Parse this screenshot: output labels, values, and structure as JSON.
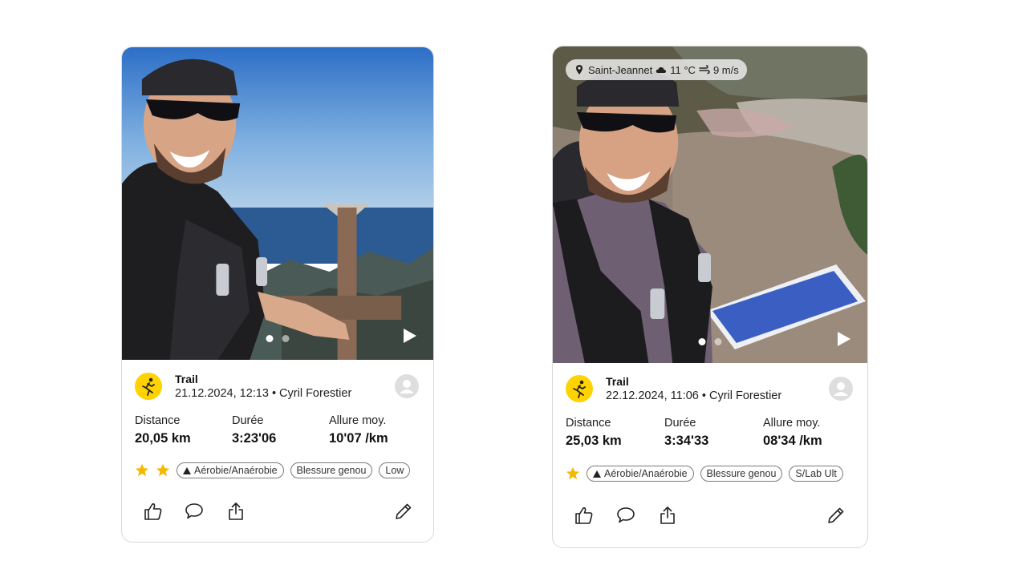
{
  "cards": [
    {
      "activity": "Trail",
      "meta": "21.12.2024, 12:13 • Cyril Forestier",
      "stats": [
        {
          "label": "Distance",
          "value": "20,05 km"
        },
        {
          "label": "Durée",
          "value": "3:23'06"
        },
        {
          "label": "Allure moy.",
          "value": "10'07 /km"
        }
      ],
      "rating": 2,
      "tags": [
        "Aérobie/Anaérobie",
        "Blessure genou",
        "Low"
      ],
      "photo_page": "1 of 2"
    },
    {
      "activity": "Trail",
      "meta": "22.12.2024, 11:06 • Cyril Forestier",
      "weather": {
        "location": "Saint-Jeannet",
        "temperature": "11 °C",
        "wind": "9 m/s"
      },
      "stats": [
        {
          "label": "Distance",
          "value": "25,03 km"
        },
        {
          "label": "Durée",
          "value": "3:34'33"
        },
        {
          "label": "Allure moy.",
          "value": "08'34 /km"
        }
      ],
      "rating": 1,
      "tags": [
        "Aérobie/Anaérobie",
        "Blessure genou",
        "S/Lab Ult"
      ],
      "photo_page": "1 of 2"
    }
  ],
  "colors": {
    "accent": "#ffd200",
    "star": "#f5b800"
  },
  "icons": [
    "location-pin-icon",
    "cloud-icon",
    "wind-icon",
    "play-icon",
    "runner-icon",
    "user-avatar-icon",
    "star-icon",
    "mountain-icon",
    "like-icon",
    "comment-icon",
    "share-icon",
    "edit-icon"
  ]
}
